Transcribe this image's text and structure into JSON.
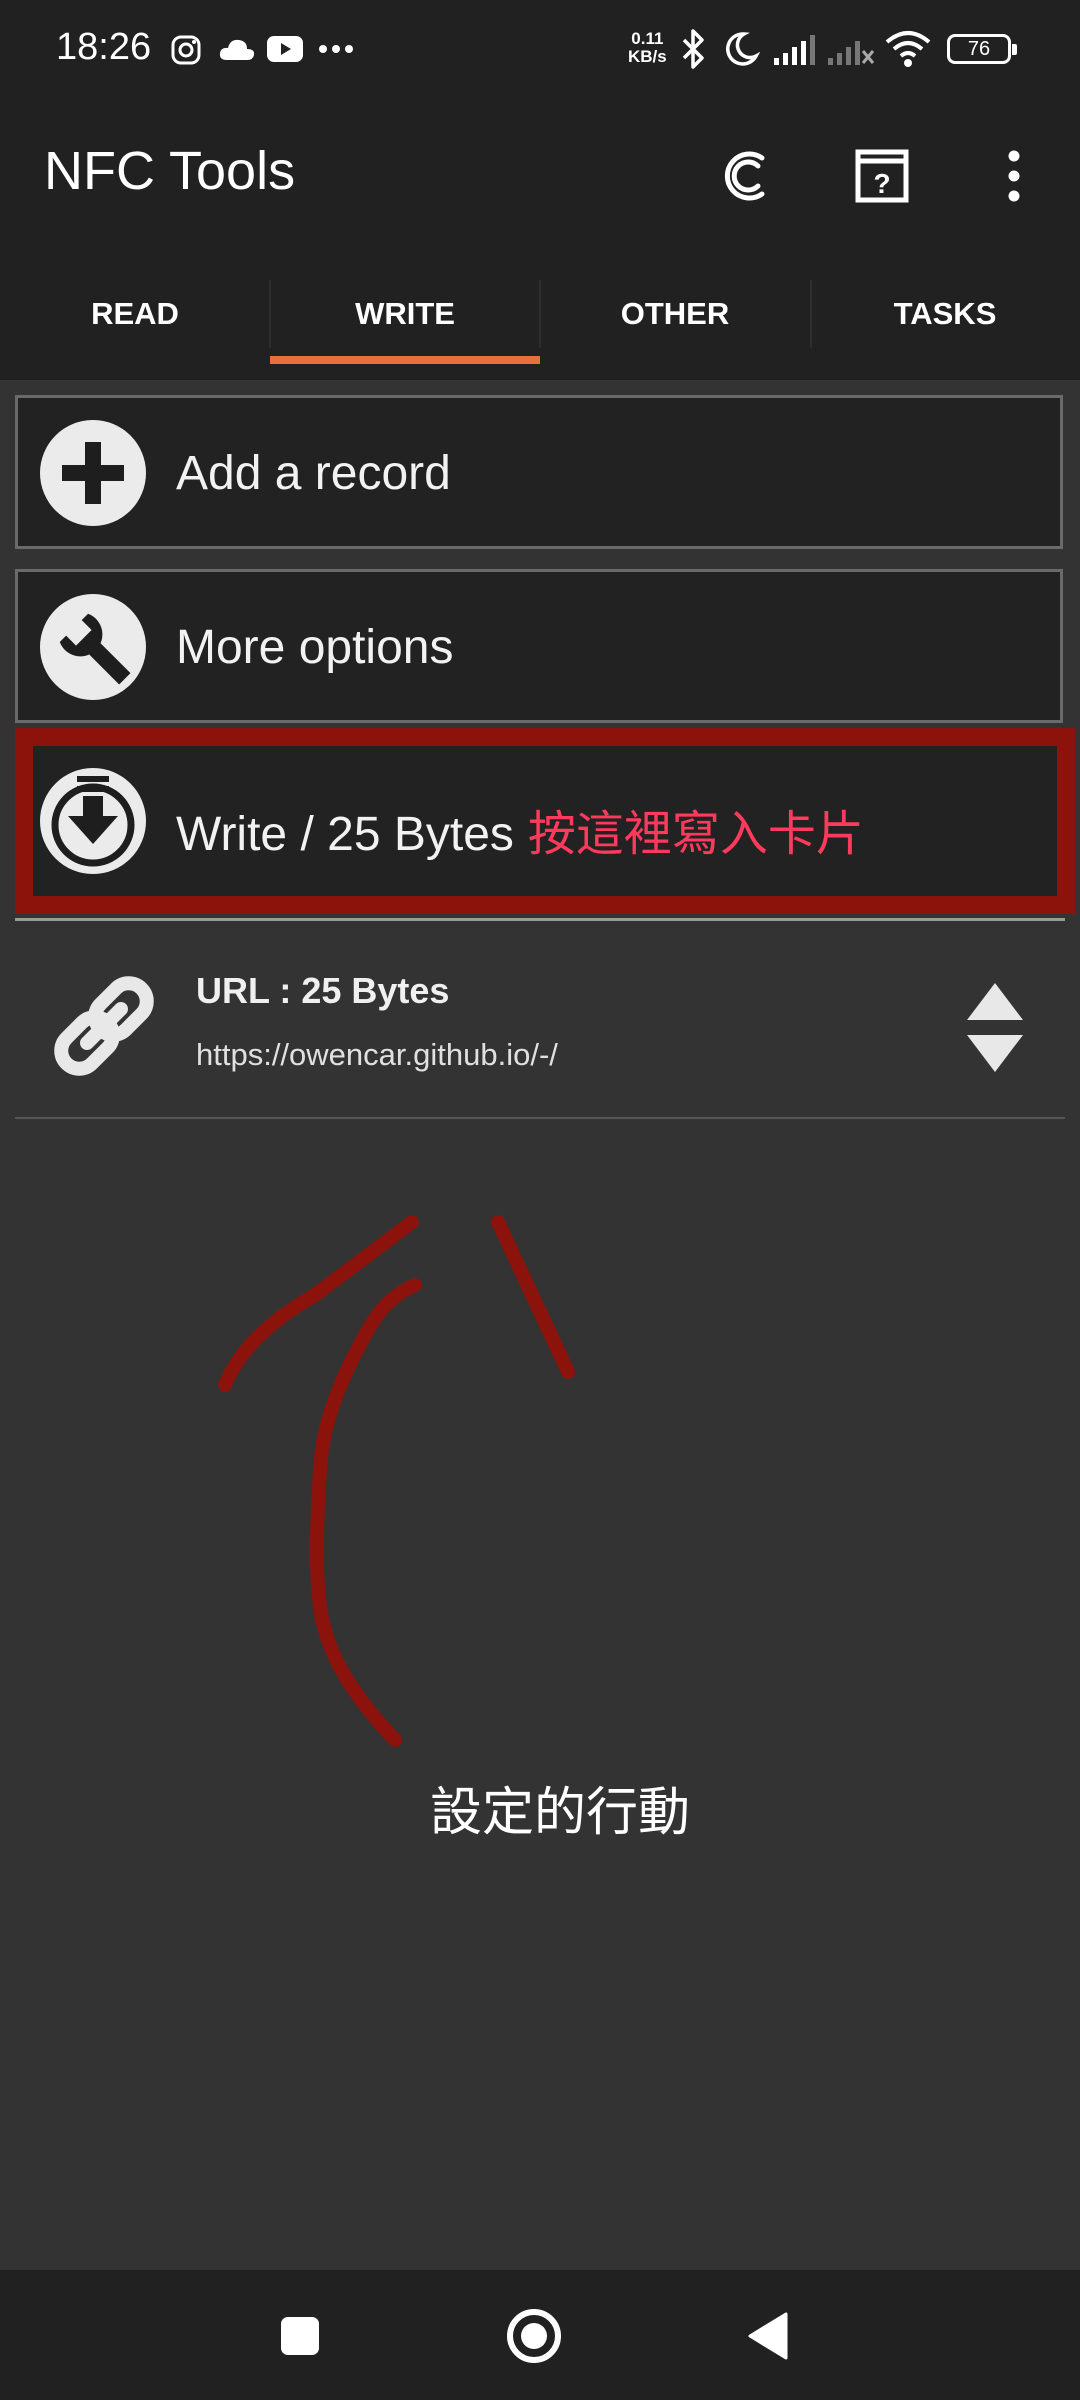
{
  "status_bar": {
    "time": "18:26",
    "net_speed_value": "0.11",
    "net_speed_unit": "KB/s",
    "battery": "76",
    "icons": [
      "instagram-icon",
      "cloud-icon",
      "youtube-icon",
      "more-dots-icon",
      "bluetooth-icon",
      "moon-icon",
      "signal-icon",
      "signal-off-icon",
      "wifi-icon",
      "battery-icon"
    ]
  },
  "app_bar": {
    "title": "NFC Tools",
    "actions": [
      "refresh-c-icon",
      "help-icon",
      "overflow-menu-icon"
    ]
  },
  "tabs": [
    {
      "label": "READ",
      "active": false
    },
    {
      "label": "WRITE",
      "active": true
    },
    {
      "label": "OTHER",
      "active": false
    },
    {
      "label": "TASKS",
      "active": false
    }
  ],
  "actions": {
    "add_record": "Add a record",
    "more_options": "More options",
    "write": "Write / 25 Bytes"
  },
  "annotations": {
    "write_hint": "按這裡寫入卡片",
    "arrow_caption": "設定的行動"
  },
  "record": {
    "title": "URL : 25 Bytes",
    "value": "https://owencar.github.io/-/",
    "icon": "link-icon"
  },
  "colors": {
    "accent": "#e8703a",
    "annotation_red": "#8b130c",
    "annotation_text": "#ff3a5c",
    "background": "#333333",
    "bars": "#212121"
  }
}
